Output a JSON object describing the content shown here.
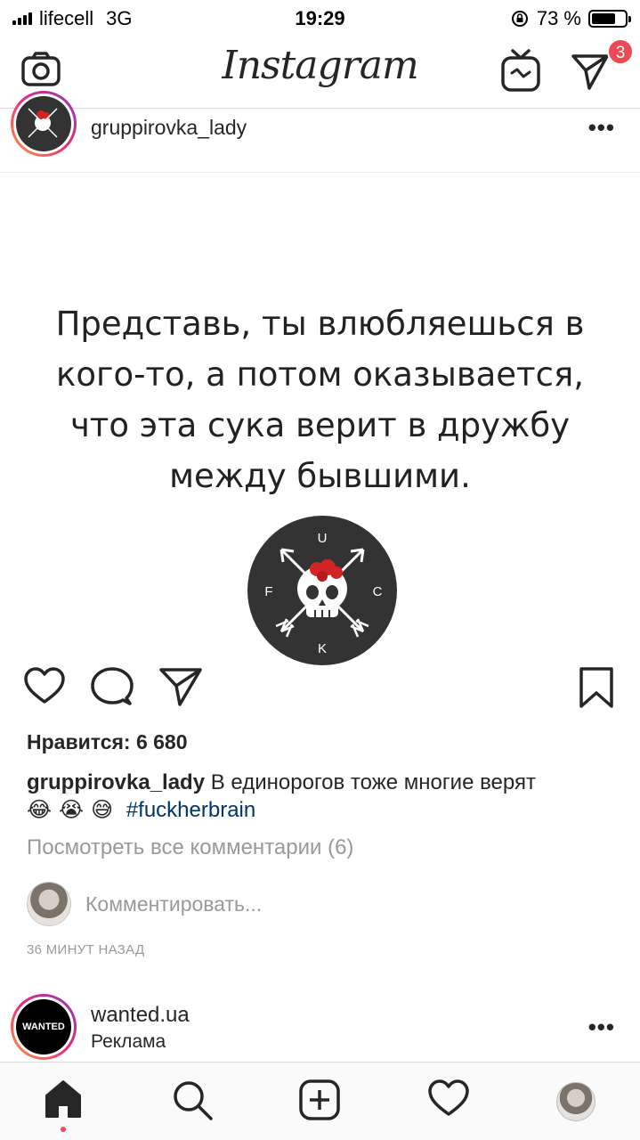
{
  "status_bar": {
    "carrier": "lifecell",
    "network": "3G",
    "time": "19:29",
    "battery_text": "73 %",
    "battery_level": 0.73
  },
  "header": {
    "logo": "Instagram",
    "direct_badge": "3",
    "icons": [
      "camera-icon",
      "igtv-icon",
      "direct-message-icon"
    ]
  },
  "post": {
    "username": "gruppirovka_lady",
    "more_label": "•••",
    "image_text": "Представь, ты влюбляешься в\nкого-то, а потом оказывается,\nчто эта сука верит в дружбу\nмежду бывшими.",
    "logo_letters": {
      "top": "U",
      "left": "F",
      "right": "C",
      "bottom": "K"
    },
    "likes": "Нравится: 6 680",
    "caption_user": "gruppirovka_lady",
    "caption_text": "В единорогов тоже многие верят",
    "caption_emojis": [
      "😂",
      "😭",
      "😅"
    ],
    "hashtag": "#fuckherbrain",
    "view_all_comments": "Посмотреть все комментарии (6)",
    "comment_placeholder": "Комментировать...",
    "time_ago": "36 МИНУТ НАЗАД"
  },
  "next_post": {
    "username": "wanted.ua",
    "subtitle": "Реклама",
    "avatar_text": "WANTED",
    "more_label": "•••"
  },
  "tabbar": {
    "items": [
      "home-icon",
      "search-icon",
      "new-post-icon",
      "activity-icon",
      "profile-avatar"
    ]
  },
  "colors": {
    "badge": "#ed4956",
    "hashtag": "#003569",
    "muted": "#999999",
    "logo_circle": "#333333",
    "roses": "#d32424"
  }
}
